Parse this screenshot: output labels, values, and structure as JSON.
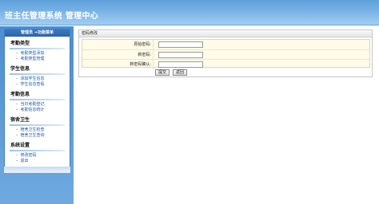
{
  "header": {
    "title": "班主任管理系统 管理中心"
  },
  "sidebar": {
    "panel_title": "管理员 →功能菜单",
    "groups": [
      {
        "title": "考勤类型",
        "items": [
          "考勤类型添加",
          "考勤类型管理"
        ]
      },
      {
        "title": "学生信息",
        "items": [
          "添加学生信息",
          "学生信息查看"
        ]
      },
      {
        "title": "考勤信息",
        "items": [
          "当日考勤登记",
          "考勤信息统计"
        ]
      },
      {
        "title": "宿舍卫生",
        "items": [
          "宿舍卫生检查",
          "宿舍卫生查询"
        ]
      },
      {
        "title": "系统设置",
        "items": [
          "修改密码",
          "退出"
        ]
      }
    ]
  },
  "main": {
    "section_title": "密码修改",
    "form": {
      "old_password_label": "原始密码:",
      "new_password_label": "新密码:",
      "confirm_password_label": "新密码确认:",
      "old_password_value": "",
      "new_password_value": "",
      "confirm_password_value": ""
    },
    "buttons": {
      "submit": "提交",
      "back": "返回"
    }
  }
}
